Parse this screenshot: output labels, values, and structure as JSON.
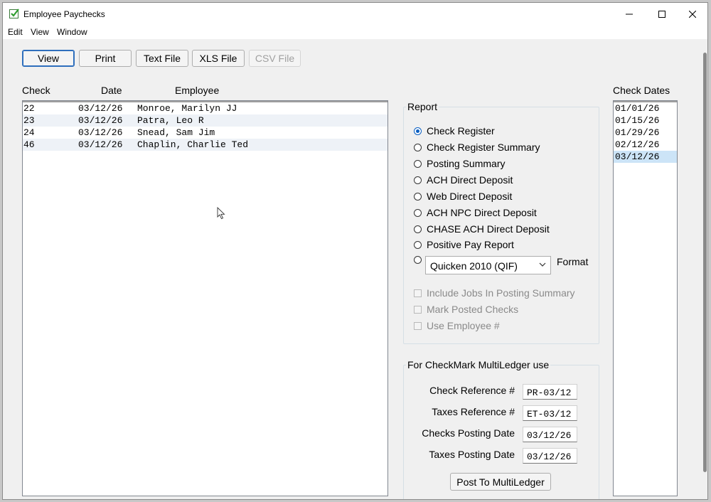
{
  "window": {
    "title": "Employee Paychecks"
  },
  "menu": [
    "Edit",
    "View",
    "Window"
  ],
  "toolbar": {
    "view": "View",
    "print": "Print",
    "text_file": "Text File",
    "xls_file": "XLS File",
    "csv_file": "CSV File"
  },
  "checks": {
    "headers": {
      "check": "Check",
      "date": "Date",
      "employee": "Employee"
    },
    "rows": [
      {
        "check": "22",
        "date": "03/12/26",
        "employee": "Monroe, Marilyn JJ"
      },
      {
        "check": "23",
        "date": "03/12/26",
        "employee": "Patra, Leo R"
      },
      {
        "check": "24",
        "date": "03/12/26",
        "employee": "Snead, Sam Jim"
      },
      {
        "check": "46",
        "date": "03/12/26",
        "employee": "Chaplin, Charlie Ted"
      }
    ]
  },
  "report": {
    "title": "Report",
    "options": [
      "Check Register",
      "Check Register Summary",
      "Posting Summary",
      "ACH Direct Deposit",
      "Web Direct Deposit",
      "ACH NPC Direct Deposit",
      "CHASE ACH Direct Deposit",
      "Positive Pay Report"
    ],
    "selected": "Check Register",
    "format_value": "Quicken 2010 (QIF)",
    "format_label": "Format",
    "checkboxes": [
      "Include Jobs In Posting Summary",
      "Mark Posted Checks",
      "Use Employee #"
    ]
  },
  "multiledger": {
    "title": "For CheckMark MultiLedger use",
    "check_reference_label": "Check Reference #",
    "check_reference": "PR-03/12",
    "taxes_reference_label": "Taxes Reference #",
    "taxes_reference": "ET-03/12",
    "checks_posting_date_label": "Checks Posting Date",
    "checks_posting_date": "03/12/26",
    "taxes_posting_date_label": "Taxes Posting Date",
    "taxes_posting_date": "03/12/26",
    "post_button": "Post To MultiLedger"
  },
  "check_dates": {
    "title": "Check Dates",
    "dates": [
      "01/01/26",
      "01/15/26",
      "01/29/26",
      "02/12/26",
      "03/12/26"
    ],
    "selected": "03/12/26"
  },
  "colors": {
    "accent": "#2f6fbd",
    "selection": "#cce4f7",
    "alt_row": "#eef2f7"
  }
}
